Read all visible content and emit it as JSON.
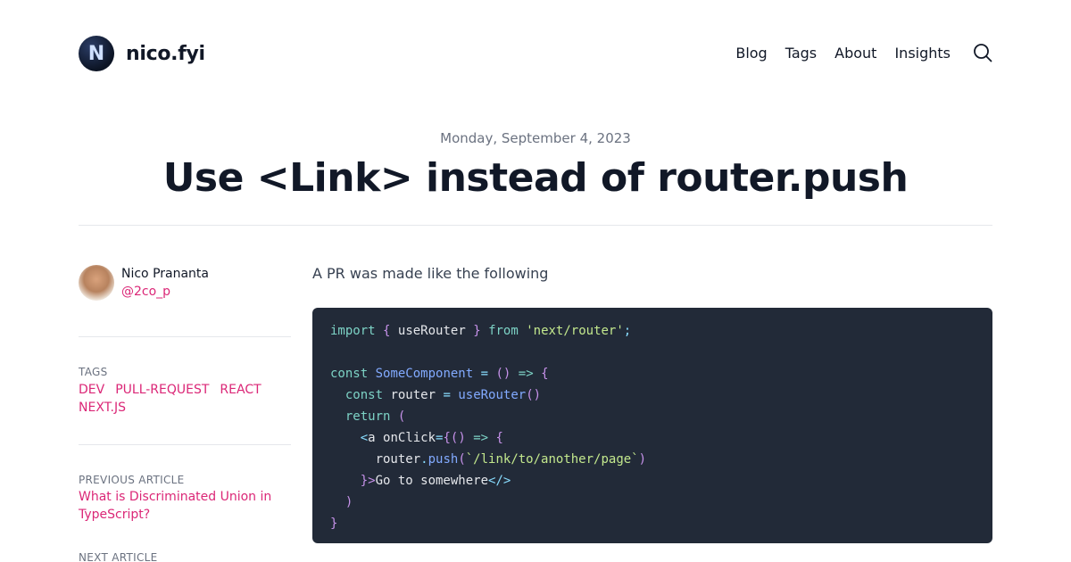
{
  "header": {
    "logo_letter": "N",
    "site_name": "nico.fyi",
    "nav": [
      "Blog",
      "Tags",
      "About",
      "Insights"
    ],
    "search_icon": "search-icon"
  },
  "article": {
    "date": "Monday, September 4, 2023",
    "title": "Use <Link> instead of router.push",
    "intro": "A PR was made like the following"
  },
  "author": {
    "name": "Nico Prananta",
    "handle": "@2co_p"
  },
  "sidebar": {
    "tags_label": "TAGS",
    "tags": [
      "DEV",
      "PULL-REQUEST",
      "REACT",
      "NEXT.JS"
    ],
    "previous_label": "PREVIOUS ARTICLE",
    "previous_title": "What is Discriminated Union in TypeScript?",
    "next_label": "NEXT ARTICLE"
  },
  "code": {
    "line1": {
      "kw": "import",
      "b1": "{",
      "name": "useRouter",
      "b2": "}",
      "from": "from",
      "str": "'next/router'",
      "semi": ";"
    },
    "line3": {
      "kw": "const",
      "name": "SomeComponent",
      "eq": "=",
      "paren": "()",
      "arrow": "=>",
      "brace": "{"
    },
    "line4": {
      "kw": "const",
      "name": "router",
      "eq": "=",
      "fn": "useRouter",
      "paren": "()"
    },
    "line5": {
      "kw": "return",
      "paren": "("
    },
    "line6": {
      "open": "<",
      "tag": "a",
      "attr": "onClick",
      "eq": "=",
      "brace": "{",
      "paren": "()",
      "arrow": "=>",
      "brace2": "{"
    },
    "line7": {
      "obj": "router",
      "dot": ".",
      "fn": "push",
      "open": "(",
      "str": "`/link/to/another/page`",
      "close": ")"
    },
    "line8": {
      "close": "}>",
      "text": "Go to somewhere",
      "end": "</>"
    },
    "line9": {
      "paren": ")"
    },
    "line10": {
      "brace": "}"
    }
  },
  "colors": {
    "accent": "#db2777",
    "code_bg": "#222a38",
    "text": "#111827",
    "muted": "#6b7280"
  }
}
